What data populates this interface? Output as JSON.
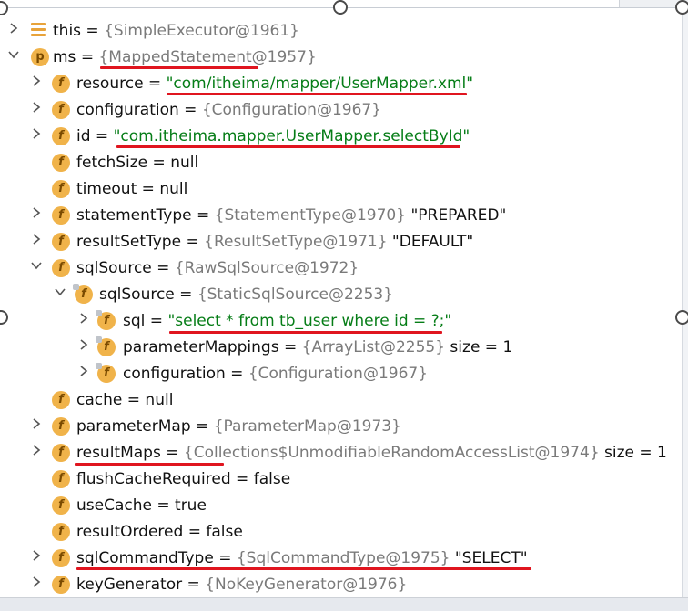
{
  "tree": [
    {
      "level": 0,
      "expand": "right",
      "icon": "list-icon",
      "name": "this",
      "eq": " = ",
      "ref": "{SimpleExecutor@1961}",
      "str": "",
      "val": ""
    },
    {
      "level": 0,
      "expand": "down",
      "icon": "p-icon",
      "name": "ms",
      "eq": " = ",
      "ref": "{MappedStatement@1957}",
      "str": "",
      "val": ""
    },
    {
      "level": 1,
      "expand": "right",
      "icon": "field-icon",
      "name": "resource",
      "eq": " = ",
      "ref": "",
      "str": "\"com/itheima/mapper/UserMapper.xml\"",
      "val": ""
    },
    {
      "level": 1,
      "expand": "right",
      "icon": "field-icon",
      "name": "configuration",
      "eq": " = ",
      "ref": "{Configuration@1967}",
      "str": "",
      "val": ""
    },
    {
      "level": 1,
      "expand": "right",
      "icon": "field-icon",
      "name": "id",
      "eq": " = ",
      "ref": "",
      "str": "\"com.itheima.mapper.UserMapper.selectById\"",
      "val": ""
    },
    {
      "level": 1,
      "expand": "",
      "icon": "field-icon",
      "name": "fetchSize",
      "eq": " = ",
      "ref": "",
      "str": "",
      "val": "null"
    },
    {
      "level": 1,
      "expand": "",
      "icon": "field-icon",
      "name": "timeout",
      "eq": " = ",
      "ref": "",
      "str": "",
      "val": "null"
    },
    {
      "level": 1,
      "expand": "right",
      "icon": "field-icon",
      "name": "statementType",
      "eq": " = ",
      "ref": "{StatementType@1970}",
      "str": "",
      "val": " \"PREPARED\""
    },
    {
      "level": 1,
      "expand": "right",
      "icon": "field-icon",
      "name": "resultSetType",
      "eq": " = ",
      "ref": "{ResultSetType@1971}",
      "str": "",
      "val": " \"DEFAULT\""
    },
    {
      "level": 1,
      "expand": "down",
      "icon": "field-icon",
      "name": "sqlSource",
      "eq": " = ",
      "ref": "{RawSqlSource@1972}",
      "str": "",
      "val": ""
    },
    {
      "level": 2,
      "expand": "down",
      "icon": "field-lock-icon",
      "name": "sqlSource",
      "eq": " = ",
      "ref": "{StaticSqlSource@2253}",
      "str": "",
      "val": ""
    },
    {
      "level": 3,
      "expand": "right",
      "icon": "field-lock-icon",
      "name": "sql",
      "eq": " = ",
      "ref": "",
      "str": "\"select * from tb_user where id = ?;\"",
      "val": ""
    },
    {
      "level": 3,
      "expand": "right",
      "icon": "field-lock-icon",
      "name": "parameterMappings",
      "eq": " = ",
      "ref": "{ArrayList@2255}",
      "str": "",
      "val": "  size = 1"
    },
    {
      "level": 3,
      "expand": "right",
      "icon": "field-lock-icon",
      "name": "configuration",
      "eq": " = ",
      "ref": "{Configuration@1967}",
      "str": "",
      "val": ""
    },
    {
      "level": 1,
      "expand": "",
      "icon": "field-icon",
      "name": "cache",
      "eq": " = ",
      "ref": "",
      "str": "",
      "val": "null"
    },
    {
      "level": 1,
      "expand": "right",
      "icon": "field-icon",
      "name": "parameterMap",
      "eq": " = ",
      "ref": "{ParameterMap@1973}",
      "str": "",
      "val": ""
    },
    {
      "level": 1,
      "expand": "right",
      "icon": "field-icon",
      "name": "resultMaps",
      "eq": " = ",
      "ref": "{Collections$UnmodifiableRandomAccessList@1974}",
      "str": "",
      "val": "  size = 1"
    },
    {
      "level": 1,
      "expand": "",
      "icon": "field-icon",
      "name": "flushCacheRequired",
      "eq": " = ",
      "ref": "",
      "str": "",
      "val": "false"
    },
    {
      "level": 1,
      "expand": "",
      "icon": "field-icon",
      "name": "useCache",
      "eq": " = ",
      "ref": "",
      "str": "",
      "val": "true"
    },
    {
      "level": 1,
      "expand": "",
      "icon": "field-icon",
      "name": "resultOrdered",
      "eq": " = ",
      "ref": "",
      "str": "",
      "val": "false"
    },
    {
      "level": 1,
      "expand": "right",
      "icon": "field-icon",
      "name": "sqlCommandType",
      "eq": " = ",
      "ref": "{SqlCommandType@1975}",
      "str": "",
      "val": " \"SELECT\""
    },
    {
      "level": 1,
      "expand": "right",
      "icon": "field-icon",
      "name": "keyGenerator",
      "eq": " = ",
      "ref": "{NoKeyGenerator@1976}",
      "str": "",
      "val": ""
    }
  ],
  "colors": {
    "string": "#067d17",
    "reference": "#7a7a7a",
    "icon": "#f0b34a",
    "underline": "#e0151f"
  }
}
